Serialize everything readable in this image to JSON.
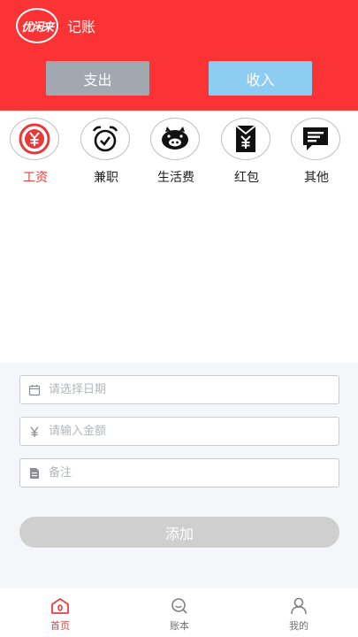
{
  "header": {
    "logo_text": "优闲来",
    "title": "记账",
    "tabs": [
      {
        "label": "支出",
        "color": "#a2a8b0"
      },
      {
        "label": "收入",
        "color": "#8ccdf1"
      }
    ],
    "background": "#fb3334"
  },
  "categories": [
    {
      "label": "工资",
      "icon": "yen-coin-icon",
      "active": true
    },
    {
      "label": "兼职",
      "icon": "alarm-clock-icon",
      "active": false
    },
    {
      "label": "生活费",
      "icon": "pig-icon",
      "active": false
    },
    {
      "label": "红包",
      "icon": "red-envelope-icon",
      "active": false
    },
    {
      "label": "其他",
      "icon": "message-icon",
      "active": false
    }
  ],
  "form": {
    "date_placeholder": "请选择日期",
    "amount_placeholder": "请输入金额",
    "note_placeholder": "备注",
    "submit_label": "添加"
  },
  "tabbar": [
    {
      "label": "首页",
      "icon": "home-icon",
      "active": true
    },
    {
      "label": "账本",
      "icon": "ledger-search-icon",
      "active": false
    },
    {
      "label": "我的",
      "icon": "user-icon",
      "active": false
    }
  ],
  "colors": {
    "accent": "#fb3334",
    "active_label": "#f23b3b"
  }
}
